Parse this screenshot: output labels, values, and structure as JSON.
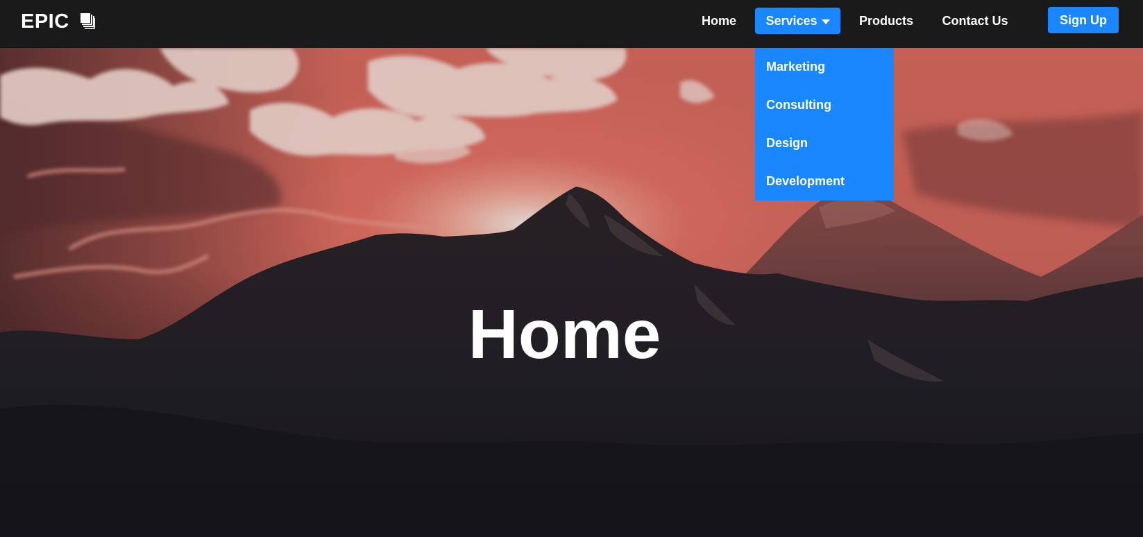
{
  "brand": {
    "name": "EPIC",
    "icon": "layers-logo-icon"
  },
  "nav": {
    "items": [
      {
        "label": "Home"
      },
      {
        "label": "Services",
        "icon": "caret-down-icon",
        "active": true
      },
      {
        "label": "Products"
      },
      {
        "label": "Contact Us"
      }
    ],
    "signup_label": "Sign Up"
  },
  "dropdown": {
    "items": [
      {
        "label": "Marketing"
      },
      {
        "label": "Consulting"
      },
      {
        "label": "Design"
      },
      {
        "label": "Development"
      }
    ]
  },
  "hero": {
    "title": "Home",
    "background": "mountain-sunset-image"
  },
  "colors": {
    "navbar_bg": "#1b1a1b",
    "accent": "#1a86ff",
    "text": "#ffffff",
    "sky_glow": "#f47a6c"
  }
}
